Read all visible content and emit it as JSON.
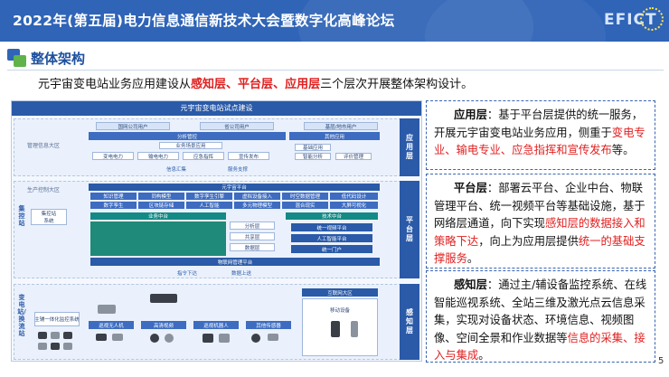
{
  "header": {
    "title": "2022年(第五届)电力信息通信新技术大会暨数字化高峰论坛",
    "logo_text": "EFICT"
  },
  "section": {
    "title": "整体架构"
  },
  "intro": {
    "prefix": "元宇宙变电站业务应用建设从",
    "layer1": "感知层",
    "sep1": "、",
    "layer2": "平台层",
    "sep2": "、",
    "layer3": "应用层",
    "suffix": "三个层次开展整体架构设计。"
  },
  "diagram": {
    "title": "元宇宙变电站试点建设",
    "band_labels": {
      "mgmt": "管理信息大区",
      "prod": "生产控制大区",
      "vtrans": "变电站/换流站"
    },
    "side_tabs": {
      "app": "应用层",
      "plat": "平台层",
      "sense": "感知层"
    },
    "group_left_label": "集控站",
    "app": {
      "users": [
        "国网公司用户",
        "省公司用户",
        "基层/地市用户"
      ],
      "group1": "分析管控",
      "group2": "其他应用",
      "sub1": "业务场景应用",
      "items_a": [
        "变电电力",
        "输电电力",
        "应急指挥",
        "宣传发布"
      ],
      "items_b": [
        "基础应用",
        "智能分析",
        "评价管理"
      ],
      "info_flow": "信息汇集",
      "service_support": "服务支撑"
    },
    "platform": {
      "title": "元宇宙平台",
      "rows": [
        [
          "知识管理",
          "同构模型",
          "数字孪生引擎",
          "虚拟设备接入",
          "时空数据管理",
          "低代码设计"
        ],
        [
          "数字孪生",
          "区块链存储",
          "人工智能",
          "多元物理模型",
          "混合现实",
          "大屏可视化"
        ]
      ],
      "biz_center": "业务中台",
      "tech_center": "技术中台",
      "biz_items": [
        "分析层",
        "共享层",
        "数据层"
      ],
      "tech_items": [
        "统一视频平台",
        "人工智能平台",
        "统一门户"
      ],
      "iot": "物联网管理平台",
      "cmd_down": "指令下达",
      "data_up": "数据上送"
    },
    "sense": {
      "main_station": "主辅一体化监控系统",
      "devices": [
        "巡视无人机",
        "高清视频",
        "巡视机器人",
        "其他传感器"
      ],
      "internet_area": "互联网大区",
      "mobile": "移动设备",
      "cmd_down": "指令下达",
      "data_up": "数据上送"
    }
  },
  "panels": {
    "app": {
      "head": "应用层",
      "text1": "：基于平台层提供的统一服务，开展元宇宙变电站业务应用，侧重于",
      "hl": "变电专业、输电专业、应急指挥和宣传发布",
      "text2": "等。"
    },
    "plat": {
      "head": "平台层",
      "text1": "：部署云平台、企业中台、物联管理平台、统一视频平台等基础设施，基于网络层通道，向下实现",
      "hl1": "感知层的数据接入和策略下达",
      "text2": "，向上为应用层提供",
      "hl2": "统一的基础支撑服务",
      "text3": "。"
    },
    "sense": {
      "head": "感知层",
      "text1": "：通过主/辅设备监控系统、在线智能巡视系统、全站三维及激光点云信息采集，实现对设备状态、环境信息、视频图像、空间全景和作业数据等",
      "hl": "信息的采集、接入与集成",
      "text2": "。"
    }
  },
  "page_number": "5",
  "colors": {
    "header_bg": "#2f64b7",
    "accent_red": "#e02020",
    "accent_green": "#5fb34a"
  }
}
